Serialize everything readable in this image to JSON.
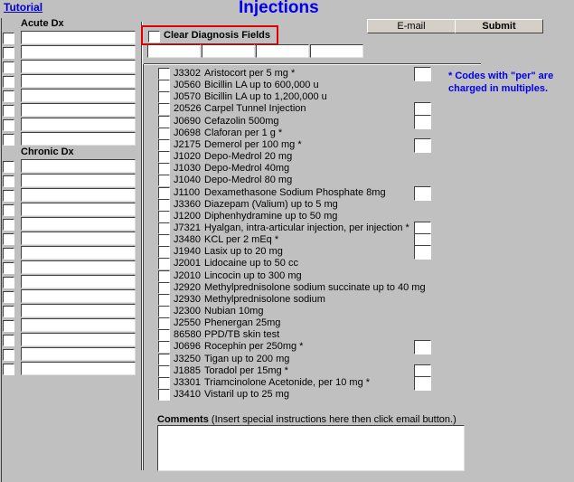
{
  "header": {
    "tutorial_link": "Tutorial",
    "title": "Injections",
    "email_button": "E-mail",
    "submit_button": "Submit"
  },
  "clear_diagnosis": {
    "label": "Clear Diagnosis Fields",
    "checked": false,
    "highlight_color": "#e00000"
  },
  "left": {
    "acute_label": "Acute Dx",
    "acute_rows": 8,
    "chronic_label": "Chronic Dx",
    "chronic_rows": 15
  },
  "note": "* Codes with \"per\" are charged in multiples.",
  "items": [
    {
      "code": "J3302",
      "name": "Aristocort per 5 mg  *",
      "qty": true
    },
    {
      "code": "J0560",
      "name": "Bicillin LA up to 600,000 u",
      "qty": false
    },
    {
      "code": "J0570",
      "name": "Bicillin LA up to 1,200,000 u",
      "qty": false
    },
    {
      "code": "20526",
      "name": "Carpel Tunnel Injection",
      "qty": true
    },
    {
      "code": "J0690",
      "name": "Cefazolin 500mg",
      "qty": true
    },
    {
      "code": "J0698",
      "name": "Claforan per 1 g  *",
      "qty": false
    },
    {
      "code": "J2175",
      "name": "Demerol per 100 mg  *",
      "qty": true
    },
    {
      "code": "J1020",
      "name": "Depo-Medrol 20 mg",
      "qty": false
    },
    {
      "code": "J1030",
      "name": "Depo-Medrol 40mg",
      "qty": false
    },
    {
      "code": "J1040",
      "name": "Depo-Medrol 80 mg",
      "qty": false
    },
    {
      "code": "J1100",
      "name": "Dexamethasone Sodium Phosphate 8mg",
      "qty": true
    },
    {
      "code": "J3360",
      "name": "Diazepam (Valium) up to 5 mg",
      "qty": false
    },
    {
      "code": "J1200",
      "name": "Diphenhydramine up to 50 mg",
      "qty": false
    },
    {
      "code": "J7321",
      "name": "Hyalgan, intra-articular injection, per injection  *",
      "qty": true
    },
    {
      "code": "J3480",
      "name": "KCL per 2 mEq  *",
      "qty": true
    },
    {
      "code": "J1940",
      "name": "Lasix up to 20 mg",
      "qty": true
    },
    {
      "code": "J2001",
      "name": "Lidocaine up to 50 cc",
      "qty": false
    },
    {
      "code": "J2010",
      "name": "Lincocin up to 300 mg",
      "qty": false
    },
    {
      "code": "J2920",
      "name": "Methylprednisolone sodium succinate up to 40 mg",
      "qty": false
    },
    {
      "code": "J2930",
      "name": "Methylprednisolone sodium",
      "qty": false
    },
    {
      "code": "J2300",
      "name": "Nubian 10mg",
      "qty": false
    },
    {
      "code": "J2550",
      "name": "Phenergan 25mg",
      "qty": false
    },
    {
      "code": "86580",
      "name": "PPD/TB skin test",
      "qty": false
    },
    {
      "code": "J0696",
      "name": "Rocephin per 250mg  *",
      "qty": true
    },
    {
      "code": "J3250",
      "name": "Tigan up to 200 mg",
      "qty": false
    },
    {
      "code": "J1885",
      "name": "Toradol per 15mg *",
      "qty": true
    },
    {
      "code": "J3301",
      "name": "Triamcinolone Acetonide, per 10 mg *",
      "qty": true
    },
    {
      "code": "J3410",
      "name": "Vistaril up to 25 mg",
      "qty": false
    }
  ],
  "comments": {
    "label": "Comments",
    "hint": " (Insert special instructions here then click email button.)",
    "value": ""
  }
}
